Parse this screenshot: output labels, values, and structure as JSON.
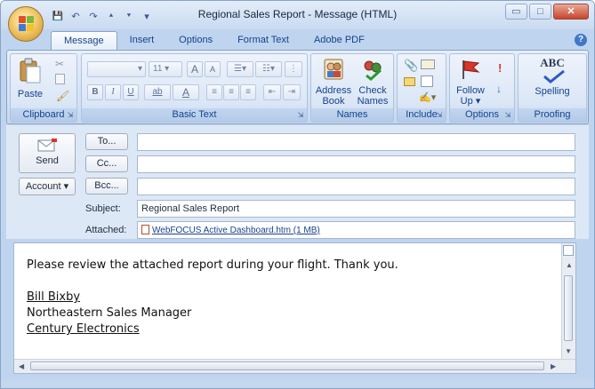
{
  "window": {
    "title": "Regional Sales Report - Message (HTML)",
    "controls": {
      "minimize": "▭",
      "maximize": "□",
      "close": "✕"
    }
  },
  "quick_access": {
    "save": "💾",
    "undo": "↶",
    "redo": "↷",
    "up": "⯅",
    "down": "⯆",
    "customize": "▾"
  },
  "tabs": [
    "Message",
    "Insert",
    "Options",
    "Format Text",
    "Adobe PDF"
  ],
  "help": "?",
  "ribbon": {
    "clipboard": {
      "label": "Clipboard",
      "paste": "Paste"
    },
    "basic_text": {
      "label": "Basic Text",
      "font_size": "11",
      "grow": "A",
      "shrink": "A",
      "bold": "B",
      "italic": "I",
      "underline": "U",
      "highlight": "ab",
      "font_color": "A"
    },
    "names": {
      "label": "Names",
      "address_book": [
        "Address",
        "Book"
      ],
      "check_names": [
        "Check",
        "Names"
      ]
    },
    "include": {
      "label": "Include"
    },
    "options": {
      "label": "Options",
      "follow_up": [
        "Follow",
        "Up ▾"
      ]
    },
    "proofing": {
      "label": "Proofing",
      "spelling": "Spelling",
      "abc": "ABC"
    }
  },
  "form": {
    "send": "Send",
    "account": "Account ▾",
    "to_button": "To...",
    "cc_button": "Cc...",
    "bcc_button": "Bcc...",
    "to_value": "",
    "cc_value": "",
    "bcc_value": "",
    "subject_label": "Subject:",
    "subject_value": "Regional Sales Report",
    "attached_label": "Attached:",
    "attachment": "WebFOCUS Active Dashboard.htm (1 MB)"
  },
  "body": {
    "line1": "Please review the attached report during your flight. Thank you.",
    "sig_name": "Bill Bixby",
    "sig_title": "Northeastern Sales Manager",
    "sig_company": "Century Electronics"
  },
  "colors": {
    "ribbon_blue": "#bfd4ef",
    "label_blue": "#15428b",
    "close_red": "#c8452b"
  }
}
